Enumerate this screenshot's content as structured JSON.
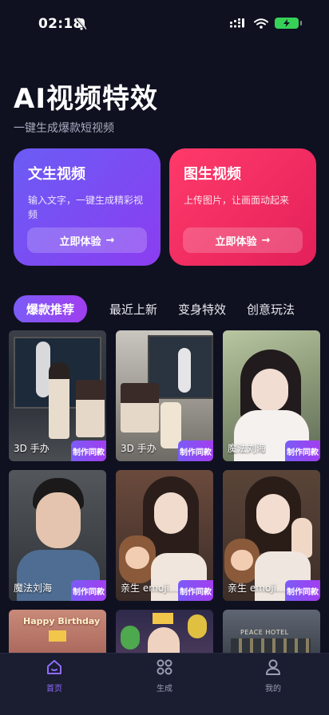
{
  "status": {
    "time": "02:18"
  },
  "hero": {
    "title": "AI视频特效",
    "subtitle": "一键生成爆款短视频"
  },
  "cards": [
    {
      "title": "文生视频",
      "desc": "输入文字，一键生成精彩视频",
      "button": "立即体验"
    },
    {
      "title": "图生视频",
      "desc": "上传图片，让画面动起来",
      "button": "立即体验"
    }
  ],
  "tabs": [
    "爆款推荐",
    "最近上新",
    "变身特效",
    "创意玩法"
  ],
  "grid": {
    "make_label": "制作同款",
    "tiles": [
      {
        "label": "3D 手办"
      },
      {
        "label": "3D 手办"
      },
      {
        "label": "魔法刘海"
      },
      {
        "label": "魔法刘海"
      },
      {
        "label": "亲生 emoji ..."
      },
      {
        "label": "亲生 emoji ..."
      },
      {
        "label": ""
      },
      {
        "label": ""
      },
      {
        "label": ""
      }
    ],
    "overlay_texts": {
      "birthday": "Happy Birthday",
      "hotel": "PEACE HOTEL"
    }
  },
  "nav": [
    {
      "label": "首页",
      "icon": "home-icon",
      "active": true
    },
    {
      "label": "生成",
      "icon": "grid-icon",
      "active": false
    },
    {
      "label": "我的",
      "icon": "user-icon",
      "active": false
    }
  ],
  "colors": {
    "accent": "#8e6cff",
    "card1": "#7b5cf7",
    "card2": "#ff3a6a",
    "bg": "#0f1120"
  }
}
